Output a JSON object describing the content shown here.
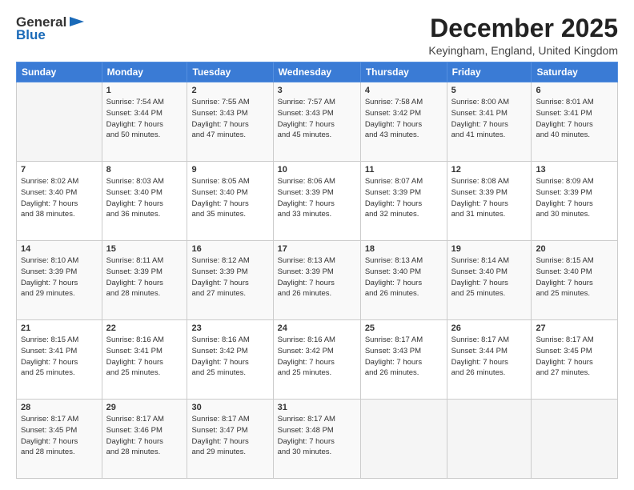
{
  "logo": {
    "general": "General",
    "blue": "Blue"
  },
  "title": "December 2025",
  "location": "Keyingham, England, United Kingdom",
  "days_header": [
    "Sunday",
    "Monday",
    "Tuesday",
    "Wednesday",
    "Thursday",
    "Friday",
    "Saturday"
  ],
  "weeks": [
    [
      {
        "day": "",
        "info": ""
      },
      {
        "day": "1",
        "info": "Sunrise: 7:54 AM\nSunset: 3:44 PM\nDaylight: 7 hours\nand 50 minutes."
      },
      {
        "day": "2",
        "info": "Sunrise: 7:55 AM\nSunset: 3:43 PM\nDaylight: 7 hours\nand 47 minutes."
      },
      {
        "day": "3",
        "info": "Sunrise: 7:57 AM\nSunset: 3:43 PM\nDaylight: 7 hours\nand 45 minutes."
      },
      {
        "day": "4",
        "info": "Sunrise: 7:58 AM\nSunset: 3:42 PM\nDaylight: 7 hours\nand 43 minutes."
      },
      {
        "day": "5",
        "info": "Sunrise: 8:00 AM\nSunset: 3:41 PM\nDaylight: 7 hours\nand 41 minutes."
      },
      {
        "day": "6",
        "info": "Sunrise: 8:01 AM\nSunset: 3:41 PM\nDaylight: 7 hours\nand 40 minutes."
      }
    ],
    [
      {
        "day": "7",
        "info": "Sunrise: 8:02 AM\nSunset: 3:40 PM\nDaylight: 7 hours\nand 38 minutes."
      },
      {
        "day": "8",
        "info": "Sunrise: 8:03 AM\nSunset: 3:40 PM\nDaylight: 7 hours\nand 36 minutes."
      },
      {
        "day": "9",
        "info": "Sunrise: 8:05 AM\nSunset: 3:40 PM\nDaylight: 7 hours\nand 35 minutes."
      },
      {
        "day": "10",
        "info": "Sunrise: 8:06 AM\nSunset: 3:39 PM\nDaylight: 7 hours\nand 33 minutes."
      },
      {
        "day": "11",
        "info": "Sunrise: 8:07 AM\nSunset: 3:39 PM\nDaylight: 7 hours\nand 32 minutes."
      },
      {
        "day": "12",
        "info": "Sunrise: 8:08 AM\nSunset: 3:39 PM\nDaylight: 7 hours\nand 31 minutes."
      },
      {
        "day": "13",
        "info": "Sunrise: 8:09 AM\nSunset: 3:39 PM\nDaylight: 7 hours\nand 30 minutes."
      }
    ],
    [
      {
        "day": "14",
        "info": "Sunrise: 8:10 AM\nSunset: 3:39 PM\nDaylight: 7 hours\nand 29 minutes."
      },
      {
        "day": "15",
        "info": "Sunrise: 8:11 AM\nSunset: 3:39 PM\nDaylight: 7 hours\nand 28 minutes."
      },
      {
        "day": "16",
        "info": "Sunrise: 8:12 AM\nSunset: 3:39 PM\nDaylight: 7 hours\nand 27 minutes."
      },
      {
        "day": "17",
        "info": "Sunrise: 8:13 AM\nSunset: 3:39 PM\nDaylight: 7 hours\nand 26 minutes."
      },
      {
        "day": "18",
        "info": "Sunrise: 8:13 AM\nSunset: 3:40 PM\nDaylight: 7 hours\nand 26 minutes."
      },
      {
        "day": "19",
        "info": "Sunrise: 8:14 AM\nSunset: 3:40 PM\nDaylight: 7 hours\nand 25 minutes."
      },
      {
        "day": "20",
        "info": "Sunrise: 8:15 AM\nSunset: 3:40 PM\nDaylight: 7 hours\nand 25 minutes."
      }
    ],
    [
      {
        "day": "21",
        "info": "Sunrise: 8:15 AM\nSunset: 3:41 PM\nDaylight: 7 hours\nand 25 minutes."
      },
      {
        "day": "22",
        "info": "Sunrise: 8:16 AM\nSunset: 3:41 PM\nDaylight: 7 hours\nand 25 minutes."
      },
      {
        "day": "23",
        "info": "Sunrise: 8:16 AM\nSunset: 3:42 PM\nDaylight: 7 hours\nand 25 minutes."
      },
      {
        "day": "24",
        "info": "Sunrise: 8:16 AM\nSunset: 3:42 PM\nDaylight: 7 hours\nand 25 minutes."
      },
      {
        "day": "25",
        "info": "Sunrise: 8:17 AM\nSunset: 3:43 PM\nDaylight: 7 hours\nand 26 minutes."
      },
      {
        "day": "26",
        "info": "Sunrise: 8:17 AM\nSunset: 3:44 PM\nDaylight: 7 hours\nand 26 minutes."
      },
      {
        "day": "27",
        "info": "Sunrise: 8:17 AM\nSunset: 3:45 PM\nDaylight: 7 hours\nand 27 minutes."
      }
    ],
    [
      {
        "day": "28",
        "info": "Sunrise: 8:17 AM\nSunset: 3:45 PM\nDaylight: 7 hours\nand 28 minutes."
      },
      {
        "day": "29",
        "info": "Sunrise: 8:17 AM\nSunset: 3:46 PM\nDaylight: 7 hours\nand 28 minutes."
      },
      {
        "day": "30",
        "info": "Sunrise: 8:17 AM\nSunset: 3:47 PM\nDaylight: 7 hours\nand 29 minutes."
      },
      {
        "day": "31",
        "info": "Sunrise: 8:17 AM\nSunset: 3:48 PM\nDaylight: 7 hours\nand 30 minutes."
      },
      {
        "day": "",
        "info": ""
      },
      {
        "day": "",
        "info": ""
      },
      {
        "day": "",
        "info": ""
      }
    ]
  ]
}
